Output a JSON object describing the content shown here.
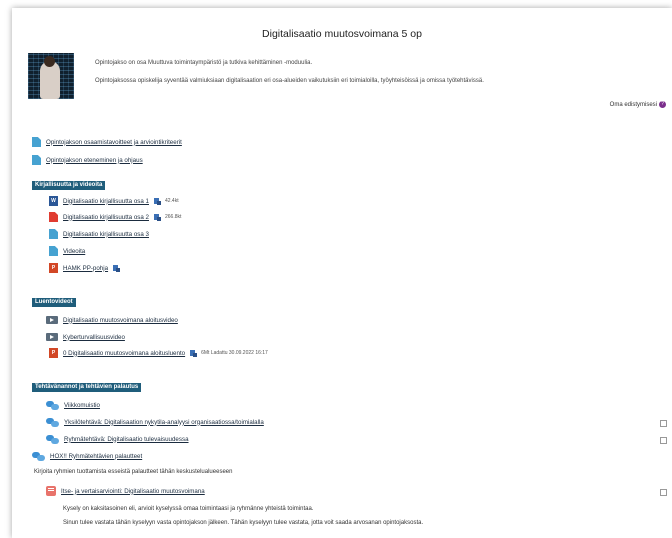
{
  "course": {
    "title": "Digitalisaatio muutosvoimana 5 op",
    "intro_1": "Opintojakso on osa Muuttuva toimintaympäristö ja tutkiva kehittäminen -moduulia.",
    "intro_2": "Opintojaksossa opiskelija syventää valmiuksiaan digitalisaation eri osa-alueiden vaikutuksiin eri toimialoilla, työyhteisöissä ja omissa työtehtävissä.",
    "progress_label": "Oma edistymisesi",
    "progress_icon": "?"
  },
  "general": [
    {
      "label": "Opintojakson osaamistavoitteet ja arviointikriteerit",
      "icon": "file-icon"
    },
    {
      "label": "Opintojakson eteneminen ja ohjaus",
      "icon": "file-icon"
    }
  ],
  "sections": {
    "literature": {
      "title": "Kirjallisuutta ja videoita",
      "items": [
        {
          "label": "Digitalisaatio kirjallisuutta osa 1",
          "icon": "word-icon",
          "size": "42.4kt"
        },
        {
          "label": "Digitalisaatio kirjallisuutta osa 2",
          "icon": "pdf-icon",
          "size": "266.8kt"
        },
        {
          "label": "Digitalisaatio kirjallisuutta osa 3",
          "icon": "file-icon"
        },
        {
          "label": "Videoita",
          "icon": "file-icon"
        },
        {
          "label": "HAMK PP-pohja",
          "icon": "ppt-icon"
        }
      ],
      "word_glyph": "W",
      "ppt_glyph": "P"
    },
    "lectures": {
      "title": "Luentovideot",
      "items": [
        {
          "label": "Digitalisaatio muutosvoimana aloitusvideo",
          "icon": "video-icon"
        },
        {
          "label": "Kyberturvallisuusvideo",
          "icon": "video-icon"
        },
        {
          "label": "0 Digitalisaatio muutosvoimana aloitusluento",
          "icon": "ppt-icon",
          "meta": "6Mt Ladattu 30.09.2022 16:17"
        }
      ]
    },
    "assignments": {
      "title": "Tehtävänannot ja tehtävien palautus",
      "items": [
        {
          "label": "Viikkomuistio",
          "icon": "forum-icon"
        },
        {
          "label": "Yksilötehtävä: Digitalisaation nykytila-analyysi organisaatiossa/toimialalla",
          "icon": "forum-icon"
        },
        {
          "label": "Ryhmätehtävä: Digitalisaatio tulevaisuudessa",
          "icon": "forum-icon"
        },
        {
          "label": "HOX!! Ryhmätehtävien palautteet",
          "icon": "forum-icon"
        }
      ],
      "feedback_note": "Kirjoita ryhmien tuottamista esseistä palautteet tähän keskustelualueeseen",
      "survey": {
        "label": "Itse- ja vertaisarviointi: Digitalisaatio muutosvoimana",
        "icon": "feedback-icon",
        "desc_1": "Kysely on kaksitasoinen eli, arvioit kyselyssä omaa toimintaasi ja ryhmänne yhteistä toimintaa.",
        "desc_2": "Sinun tulee vastata tähän kyselyyn vasta opintojakson jälkeen. Tähän kyselyyn tulee vastata, jotta voit saada arvosanan opintojaksosta."
      }
    }
  }
}
